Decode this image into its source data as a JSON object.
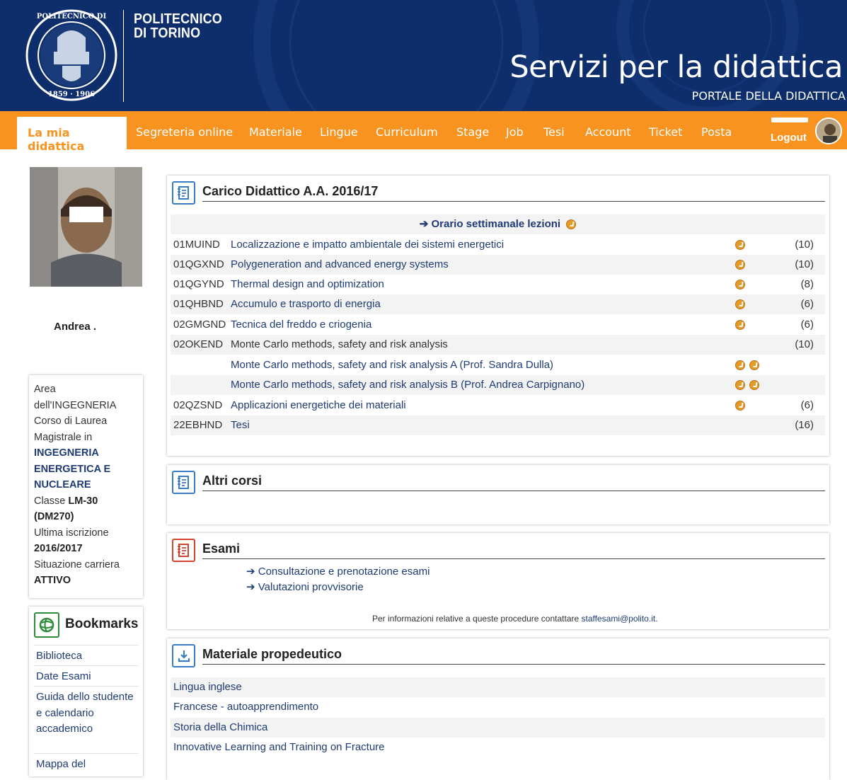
{
  "header": {
    "university_line1": "POLITECNICO",
    "university_line2": "DI TORINO",
    "service_title": "Servizi per la didattica",
    "portal_subtitle": "PORTALE DELLA DIDATTICA",
    "logo_icon": "university-seal-icon"
  },
  "nav": {
    "active": "La mia didattica",
    "items": [
      "Segreteria online",
      "Materiale",
      "Lingue",
      "Curriculum",
      "Stage",
      "Job",
      "Tesi",
      "Account",
      "Ticket",
      "Posta"
    ],
    "logout": "Logout"
  },
  "user": {
    "name": "Andrea .",
    "info": {
      "area": "Area dell'INGEGNERIA",
      "corso_label": "Corso di Laurea Magistrale in",
      "corso_value": "INGEGNERIA ENERGETICA E NUCLEARE",
      "classe_label": "Classe",
      "classe_value": "LM-30 (DM270)",
      "iscrizione_label": "Ultima iscrizione",
      "iscrizione_value": "2016/2017",
      "carriera_label": "Situazione carriera",
      "carriera_value": "ATTIVO"
    }
  },
  "bookmarks": {
    "title": "Bookmarks",
    "items": [
      "Biblioteca",
      "Date Esami",
      "Guida dello studente e calendario accademico",
      "Mappa del"
    ]
  },
  "carico": {
    "title": "Carico Didattico A.A. 2016/17",
    "orario_link": "Orario settimanale lezioni",
    "courses": [
      {
        "code": "01MUIND",
        "name": "Localizzazione e impatto ambientale dei sistemi energetici",
        "credits": "(10)"
      },
      {
        "code": "01QGXND",
        "name": "Polygeneration and advanced energy systems",
        "credits": "(10)"
      },
      {
        "code": "01QGYND",
        "name": "Thermal design and optimization",
        "credits": "(8)"
      },
      {
        "code": "01QHBND",
        "name": "Accumulo e trasporto di energia",
        "credits": "(6)"
      },
      {
        "code": "02GMGND",
        "name": "Tecnica del freddo e criogenia",
        "credits": "(6)"
      },
      {
        "code": "02OKEND",
        "name": "Monte Carlo methods, safety and risk analysis",
        "credits": "(10)"
      },
      {
        "code": "",
        "name": "Monte Carlo methods, safety and risk analysis A (Prof. Sandra Dulla)",
        "credits": ""
      },
      {
        "code": "",
        "name": "Monte Carlo methods, safety and risk analysis B (Prof. Andrea Carpignano)",
        "credits": ""
      },
      {
        "code": "02QZSND",
        "name": "Applicazioni energetiche dei materiali",
        "credits": "(6)"
      },
      {
        "code": "22EBHND",
        "name": "Tesi",
        "credits": "(16)"
      }
    ]
  },
  "altri": {
    "title": "Altri corsi"
  },
  "esami": {
    "title": "Esami",
    "links": [
      "Consultazione e prenotazione esami",
      "Valutazioni provvisorie"
    ],
    "info_text": "Per informazioni relative a queste procedure contattare",
    "info_email": "staffesami@polito.it."
  },
  "materiale": {
    "title": "Materiale propedeutico",
    "items": [
      "Lingua inglese",
      "Francese - autoapprendimento",
      "Storia della Chimica",
      "Innovative Learning and Training on Fracture"
    ]
  },
  "colors": {
    "navy": "#0d2d6b",
    "orange": "#f7931e",
    "link": "#1f3b74"
  }
}
